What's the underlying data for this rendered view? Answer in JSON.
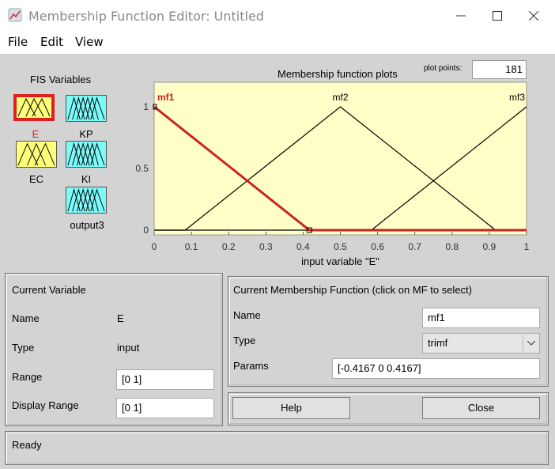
{
  "window": {
    "title": "Membership Function Editor: Untitled"
  },
  "menu": [
    "File",
    "Edit",
    "View"
  ],
  "fis": {
    "heading": "FIS Variables",
    "inputs": [
      {
        "label": "E",
        "selected": true,
        "color": "#ffff7a"
      },
      {
        "label": "EC",
        "selected": false,
        "color": "#ffff7a"
      }
    ],
    "outputs": [
      {
        "label": "KP",
        "color": "#7dfafa"
      },
      {
        "label": "KI",
        "color": "#7dfafa"
      },
      {
        "label": "output3",
        "color": "#7dfafa"
      }
    ]
  },
  "plot": {
    "title": "Membership function plots",
    "points_label": "plot points:",
    "points_value": "181"
  },
  "chart_data": {
    "type": "line",
    "xlabel": "input variable \"E\"",
    "xlim": [
      0,
      1
    ],
    "ylim": [
      0,
      1
    ],
    "xticks": [
      "0",
      "0.1",
      "0.2",
      "0.3",
      "0.4",
      "0.5",
      "0.6",
      "0.7",
      "0.8",
      "0.9",
      "1"
    ],
    "yticks": [
      "0",
      "0.5",
      "1"
    ],
    "background": "#ffffc8",
    "series": [
      {
        "name": "mf1",
        "selected": true,
        "color": "#cc2222",
        "x": [
          -0.4167,
          0,
          0.4167,
          1
        ],
        "y": [
          0,
          1,
          0,
          0
        ]
      },
      {
        "name": "mf2",
        "selected": false,
        "color": "#000000",
        "x": [
          0,
          0.0833,
          0.5,
          0.9167,
          1
        ],
        "y": [
          0,
          0,
          1,
          0,
          0
        ]
      },
      {
        "name": "mf3",
        "selected": false,
        "color": "#000000",
        "x": [
          0,
          0.5833,
          1
        ],
        "y": [
          0,
          0,
          1
        ]
      }
    ]
  },
  "current_variable": {
    "heading": "Current Variable",
    "name_label": "Name",
    "name_value": "E",
    "type_label": "Type",
    "type_value": "input",
    "range_label": "Range",
    "range_value": "[0 1]",
    "display_range_label": "Display Range",
    "display_range_value": "[0 1]"
  },
  "current_mf": {
    "heading": "Current Membership Function (click on MF to select)",
    "name_label": "Name",
    "name_value": "mf1",
    "type_label": "Type",
    "type_value": "trimf",
    "params_label": "Params",
    "params_value": "[-0.4167 0 0.4167]"
  },
  "buttons": {
    "help": "Help",
    "close": "Close"
  },
  "status": "Ready"
}
